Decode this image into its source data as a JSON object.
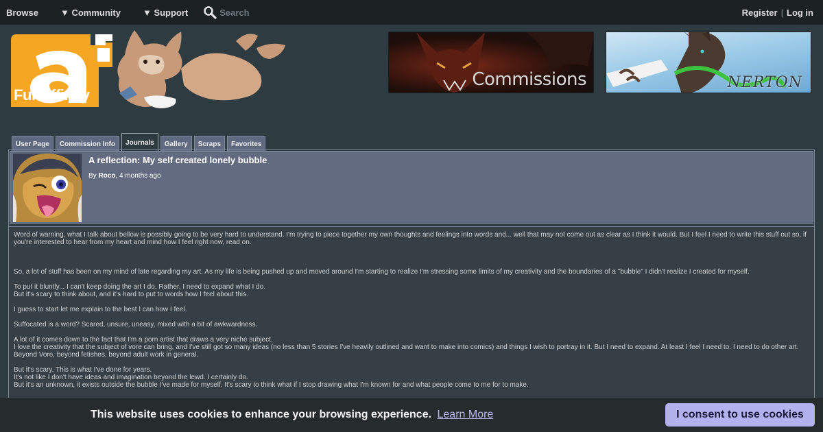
{
  "topnav": {
    "browse": "Browse",
    "community": "▼ Community",
    "support": "▼ Support",
    "search_placeholder": "Search",
    "register": "Register",
    "separator": "|",
    "login": "Log in"
  },
  "logo": {
    "text": "Fur Affinity"
  },
  "banners": [
    {
      "label": "Commissions"
    },
    {
      "label": "NERTON"
    }
  ],
  "tabs": [
    {
      "label": "User Page"
    },
    {
      "label": "Commission Info"
    },
    {
      "label": "Journals"
    },
    {
      "label": "Gallery"
    },
    {
      "label": "Scraps"
    },
    {
      "label": "Favorites"
    }
  ],
  "journal": {
    "title": "A reflection: My self created lonely bubble",
    "by_label": "By",
    "author": "Roco",
    "posted": ", 4 months ago",
    "paragraphs": [
      "Word of warning, what I talk about bellow is possibly going to be very hard to understand. I'm trying to piece together my own thoughts and feelings into words and... well that may not come out as clear as I think it would. But I feel I need to write this stuff out so, if you're interested to hear from my heart and mind how I feel right now, read on.",
      "",
      "",
      "So, a lot of stuff has been on my mind of late regarding my art. As my life is being pushed up and moved around I'm starting to realize I'm stressing some limits of my creativity and the boundaries of a \"bubble\" I didn't realize I created for myself.",
      "To put it bluntly... I can't keep doing the art I do. Rather, I need to expand what I do.\nBut it's scary to think about, and it's hard to put to words how I feel about this.",
      "I guess to start let me explain to the best I can how I feel.",
      "Suffocated is a word? Scared, unsure, uneasy, mixed with a bit of awkwardness.",
      "A lot of it comes down to the fact that I'm a porn artist that draws a very niche subject.\nI love the creativity that the subject of vore can bring, and I've still got so many ideas (no less than 5 stories I've heavily outlined and want to make into comics) and things I wish to portray in it. But I need to expand. At least I feel I need to. I need to do other art. Beyond Vore, beyond fetishes, beyond adult work in general.",
      "But it's scary. This is what I've done for years.\nIt's not like I don't have ideas and imagination beyond the lewd. I certainly do.\nBut it's an unknown, it exists outside the bubble I've made for myself. It's scary to think what if I stop drawing what I'm known for and what people come to me for to make."
    ]
  },
  "cookie": {
    "message": "This website uses cookies to enhance your browsing experience.",
    "learn_more": "Learn More",
    "consent": "I consent to use cookies"
  }
}
